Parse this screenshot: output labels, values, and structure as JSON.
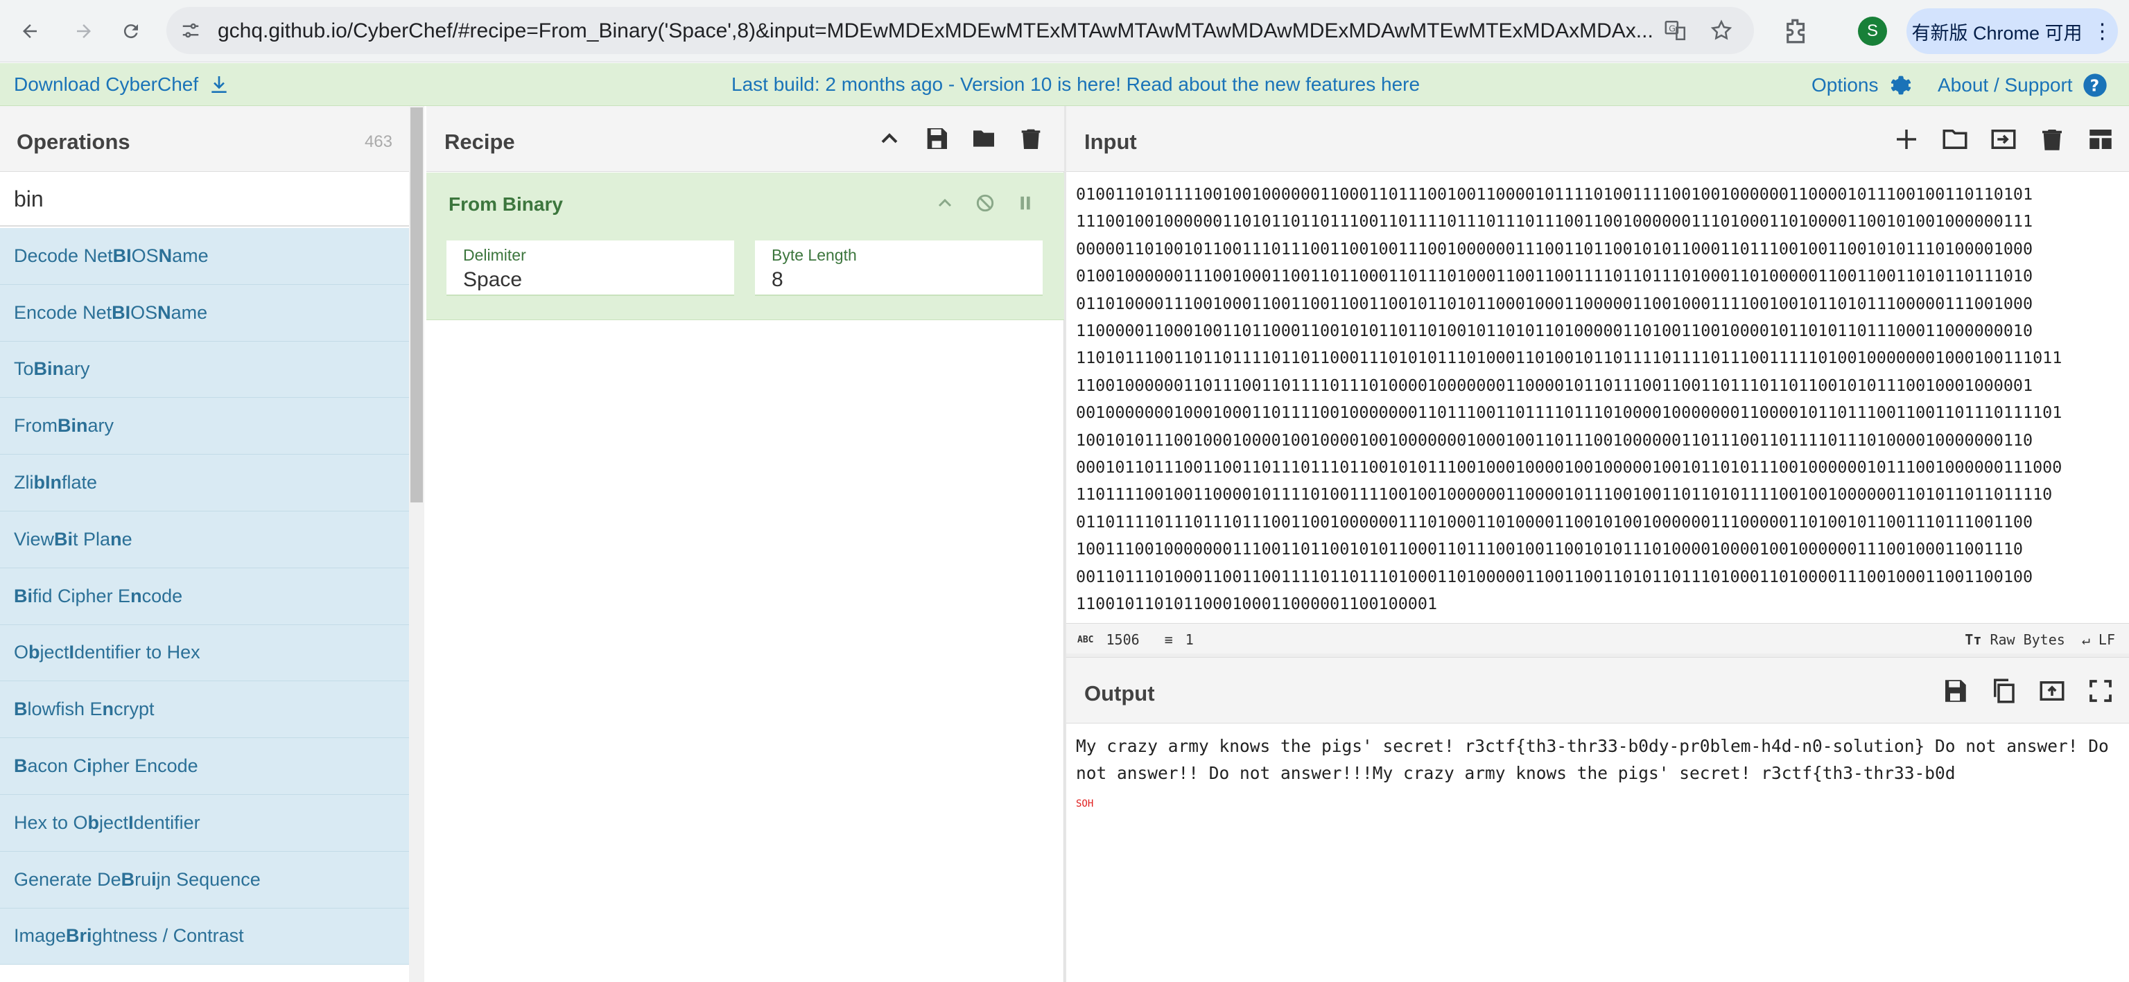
{
  "browser": {
    "url": "gchq.github.io/CyberChef/#recipe=From_Binary('Space',8)&input=MDEwMDExMDEwMTExMTAwMTAwMTAwMDAwMDExMDAwMTEwMTExMDAxMDAx...",
    "chrome_update_label": "有新版 Chrome 可用",
    "profile_initial": "S"
  },
  "banner": {
    "download_label": "Download CyberChef",
    "notice": "Last build: 2 months ago - Version 10 is here! Read about the new features here",
    "options_label": "Options",
    "about_label": "About / Support"
  },
  "operations": {
    "title": "Operations",
    "count": "463",
    "search_value": "bin",
    "items": [
      {
        "pre": "Decode Net",
        "hl": "BI",
        "mid": "OS ",
        "hl2": "N",
        "post": "ame"
      },
      {
        "pre": "Encode Net",
        "hl": "BI",
        "mid": "OS ",
        "hl2": "N",
        "post": "ame"
      },
      {
        "pre": "To ",
        "hl": "Bin",
        "mid": "ary",
        "hl2": "",
        "post": ""
      },
      {
        "pre": "From ",
        "hl": "Bin",
        "mid": "ary",
        "hl2": "",
        "post": ""
      },
      {
        "pre": "Zli",
        "hl": "b",
        "mid": " ",
        "hl2": "In",
        "post": "flate"
      },
      {
        "pre": "View ",
        "hl": "Bi",
        "mid": "t Pla",
        "hl2": "n",
        "post": "e"
      },
      {
        "pre": "",
        "hl": "Bi",
        "mid": "fid Cipher E",
        "hl2": "n",
        "post": "code"
      },
      {
        "pre": "O",
        "hl": "b",
        "mid": "ject ",
        "hl2": "I",
        "post": "dentifier to Hex"
      },
      {
        "pre": "",
        "hl": "B",
        "mid": "lowfish E",
        "hl2": "n",
        "post": "crypt"
      },
      {
        "pre": "",
        "hl": "B",
        "mid": "acon C",
        "hl2": "i",
        "post": "pher Encode"
      },
      {
        "pre": "Hex to O",
        "hl": "b",
        "mid": "ject ",
        "hl2": "I",
        "post": "dentifier"
      },
      {
        "pre": "Generate De ",
        "hl": "B",
        "mid": "ru",
        "hl2": "i",
        "post": "jn Sequence"
      },
      {
        "pre": "Image ",
        "hl": "Bri",
        "mid": "ghtness / Contrast",
        "hl2": "",
        "post": ""
      }
    ]
  },
  "recipe": {
    "title": "Recipe",
    "operation_title": "From Binary",
    "delimiter_label": "Delimiter",
    "delimiter_value": "Space",
    "byte_length_label": "Byte Length",
    "byte_length_value": "8"
  },
  "input": {
    "title": "Input",
    "lines": [
      "01001101011110010010000001100011011100100110000101111010011110010010000001100001011100100110110101",
      "11100100100000011010110110111001101111011101110111001100100000011101000110100001100101001000000111",
      "00000110100101100111011100110010011100100000011100110110010101100011011100100110010101110100001000",
      "01001000000111001000110011011000110111010001100110011110110111010001101000001100110011010110111010",
      "01101000011100100011001100110011001011010110001000110000011001000111100100101101011100000111001000",
      "11000001100010011011000110010101101101001011010110100000110100110010000101101011011100011000000010",
      "11010111001101101111011011000111010101110100011010010110111101111011100111110100100000001000100111011",
      "11001000000110111001101111011101000010000000110000101101110011001101110110110010101110010001000001",
      "00100000001000100011011110010000000110111001101111011101000010000000110000101101110011001101110111101",
      "10010101110010001000010010000100100000001000100110111001000000110111001101111011101000010000000110",
      "00010110111001100110111011101100101011100100010000100100000100101101011100100000010111001000000111000",
      "1101111001001100001011110100111100100100000011000010111001001101101011110010010000001101011011011110",
      "01101111011101110111001100100000011101000110100001100101001000000111000001101001011001110111001100",
      "1001110010000000111001101100101011000110111001001100101011101000010000100100000011100100011001110",
      "00110111010001100110011110110111010001101000001100110011010110111010001101000011100100011001100100",
      "1100101101011000100011000001100100001"
    ],
    "char_count": "1506",
    "line_count": "1",
    "encoding_label": "Raw Bytes",
    "eol_label": "LF"
  },
  "output": {
    "title": "Output",
    "text": "My crazy army knows the pigs' secret! r3ctf{th3-thr33-b0dy-pr0blem-h4d-n0-solution} Do not answer! Do not answer!! Do not answer!!!My crazy army knows the pigs' secret! r3ctf{th3-thr33-b0d",
    "trailing_char": "SOH"
  }
}
